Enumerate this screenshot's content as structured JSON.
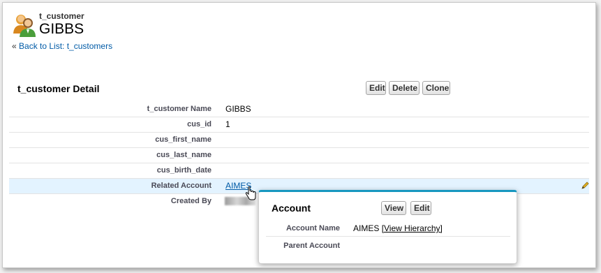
{
  "header": {
    "object_type": "t_customer",
    "record_name": "GIBBS",
    "back_prefix": "« ",
    "back_link": "Back to List: t_customers"
  },
  "detail": {
    "title": "t_customer Detail",
    "buttons": {
      "edit": "Edit",
      "delete": "Delete",
      "clone": "Clone"
    },
    "rows": [
      {
        "label": "t_customer Name",
        "value": "GIBBS"
      },
      {
        "label": "cus_id",
        "value": "1"
      },
      {
        "label": "cus_first_name",
        "value": ""
      },
      {
        "label": "cus_last_name",
        "value": ""
      },
      {
        "label": "cus_birth_date",
        "value": ""
      },
      {
        "label": "Related Account",
        "value": "AIMES"
      },
      {
        "label": "Created By",
        "value": ""
      }
    ]
  },
  "popup": {
    "title": "Account",
    "buttons": {
      "view": "View",
      "edit": "Edit"
    },
    "rows": [
      {
        "label": "Account Name",
        "value": "AIMES",
        "link": "[View Hierarchy]"
      },
      {
        "label": "Parent Account",
        "value": ""
      }
    ]
  },
  "colors": {
    "link": "#015ba7",
    "highlight_row": "#e3f3ff",
    "popup_accent": "#1797c0"
  }
}
